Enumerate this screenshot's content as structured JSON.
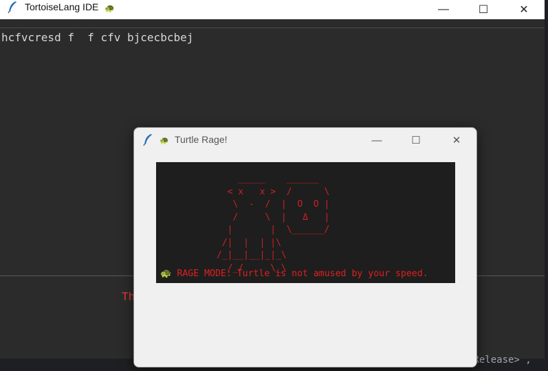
{
  "main_window": {
    "title": "TortoiseLang IDE",
    "title_turtle": "🐢",
    "editor_text": "hcfvcresd f  f cfv bjcecbcbej",
    "output_text": "Th"
  },
  "background": {
    "bottom_code": "/Release> ,"
  },
  "popup": {
    "title": "Turtle Rage!",
    "title_turtle": "🐢",
    "ascii_art": "    _____    ______\n  < x   x >  /      \\\n   \\  -  /  |  O  O |\n   /     \\  |   Δ   |\n  |       |  \\______/\n /|  |  | |\\\n/_|__|__|_|_\\\n  /_/     \\_\\",
    "rage_icon": "🐢",
    "rage_message": "RAGE MODE: Turtle is not amused by your speed."
  },
  "controls": {
    "minimize": "—",
    "maximize": "☐",
    "close": "✕"
  },
  "colors": {
    "rage_red": "#d02020",
    "canvas_bg": "#1e1e1e",
    "editor_bg": "#2b2b2b"
  }
}
